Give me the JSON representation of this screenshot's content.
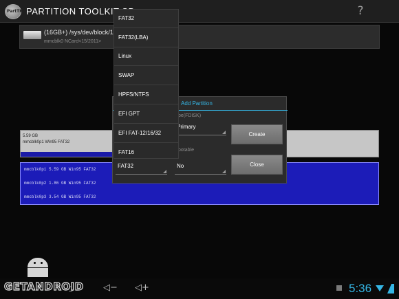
{
  "app": {
    "logo_text": "PartTK",
    "title": "PARTITION TOOLKIT SD",
    "help_glyph": "?"
  },
  "device": {
    "line1": "(16GB+) /sys/dev/block/1",
    "line2": "mmcblk0 NCard<15/2011>"
  },
  "partition_bar": {
    "size": "5.59 GB",
    "label": "mmcblk0p1 Win95 FAT32",
    "fill_fraction": 0.47
  },
  "partition_list": [
    "mmcblk0p1 5.59 GB Win95 FAT32",
    "mmcblk0p2 1.86 GB Win95 FAT32",
    "mmcblk0p3 3.54 GB Win95 FAT32"
  ],
  "dialog": {
    "title": "Add Partition",
    "type_label": "pe(FDISK)",
    "type_value": "Primary",
    "boot_label": "ootable",
    "fs_value": "FAT32",
    "boot_value": "No",
    "create_label": "Create",
    "close_label": "Close"
  },
  "dropdown": {
    "options": [
      "FAT32",
      "FAT32(LBA)",
      "Linux",
      "SWAP",
      "HPFS/NTFS",
      "EFI GPT",
      "EFI FAT-12/16/32",
      "FAT16"
    ]
  },
  "navbar": {
    "time": "5:36",
    "back_glyph": "⮌",
    "vol_down_glyph": "◁−",
    "vol_up_glyph": "◁+"
  },
  "watermark": {
    "text": "GETANDROID"
  },
  "colors": {
    "accent": "#35b6e5",
    "partition_blue": "#1c1cb8"
  }
}
